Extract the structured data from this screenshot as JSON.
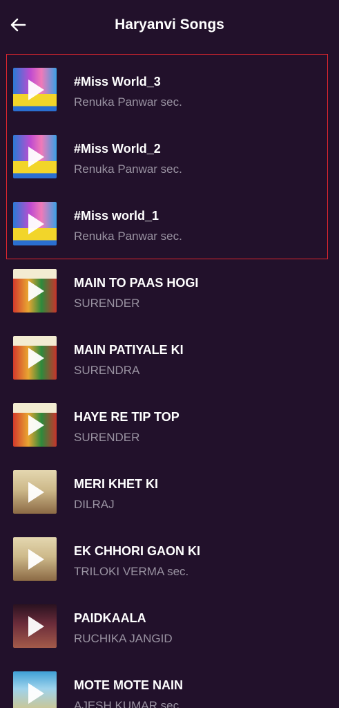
{
  "header": {
    "title": "Haryanvi Songs",
    "back_icon": "arrow-left-icon"
  },
  "colors": {
    "background": "#22112b",
    "highlight_border": "#e0262e",
    "title_text": "#ffffff",
    "subtitle_text": "#9a93a2"
  },
  "songs": [
    {
      "title": "#Miss World_3",
      "artist": "Renuka Panwar sec."
    },
    {
      "title": "#Miss World_2",
      "artist": "Renuka Panwar sec."
    },
    {
      "title": "#Miss world_1",
      "artist": "Renuka Panwar sec."
    },
    {
      "title": "MAIN TO PAAS HOGI",
      "artist": "SURENDER"
    },
    {
      "title": "MAIN PATIYALE KI",
      "artist": "SURENDRA"
    },
    {
      "title": "HAYE RE TIP TOP",
      "artist": "SURENDER"
    },
    {
      "title": "MERI KHET KI",
      "artist": "DILRAJ"
    },
    {
      "title": "EK CHHORI GAON KI",
      "artist": "TRILOKI VERMA sec."
    },
    {
      "title": "PAIDKAALA",
      "artist": "RUCHIKA JANGID"
    },
    {
      "title": "MOTE MOTE NAIN",
      "artist": "AJESH KUMAR sec."
    }
  ]
}
